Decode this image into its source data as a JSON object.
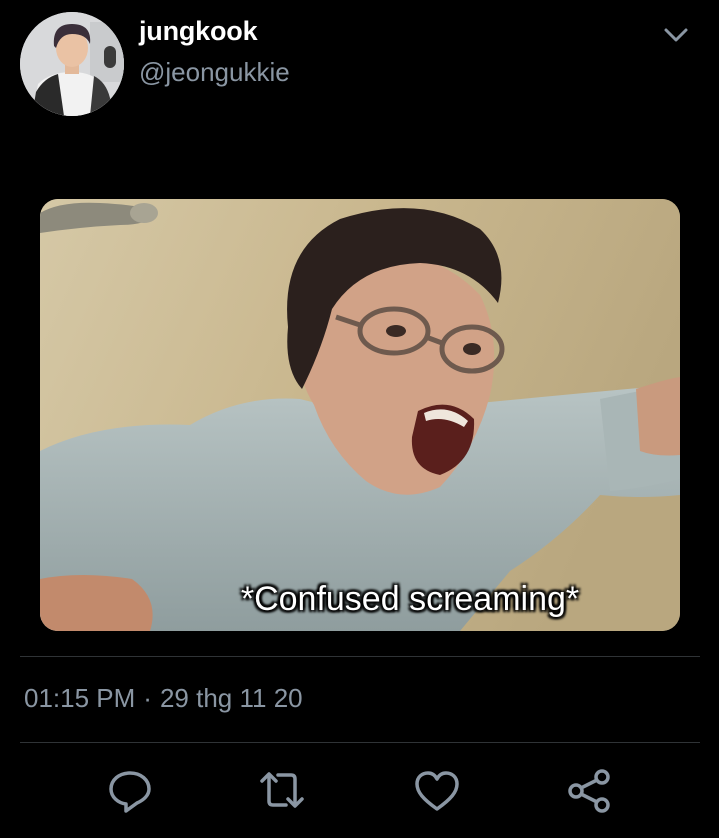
{
  "tweet": {
    "display_name": "jungkook",
    "handle": "@jeongukkie",
    "media_caption": "*Confused screaming*",
    "time": "01:15 PM",
    "separator": "·",
    "date": "29 thg 11 20"
  },
  "icons": {
    "more": "chevron-down-icon",
    "reply": "reply-icon",
    "retweet": "retweet-icon",
    "like": "heart-icon",
    "share": "share-icon"
  },
  "colors": {
    "background": "#000000",
    "primary_text": "#ffffff",
    "secondary_text": "#8a96a3",
    "icon": "#8a96a3",
    "divider": "#2f3336"
  }
}
